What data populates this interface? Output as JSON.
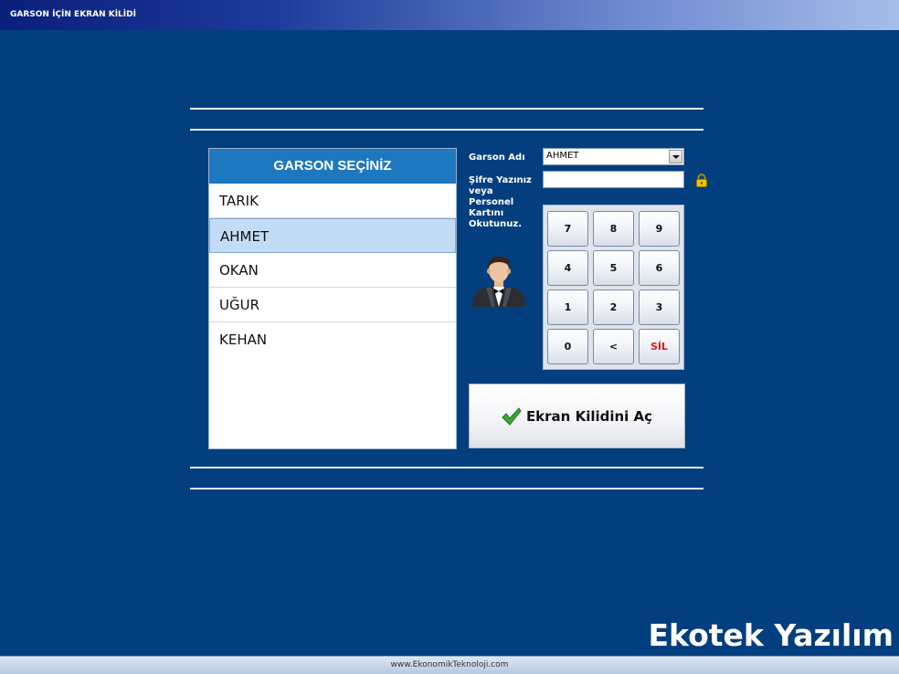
{
  "window": {
    "title": "GARSON İÇİN EKRAN KİLİDİ"
  },
  "waiter_list": {
    "header": "GARSON SEÇİNİZ",
    "items": [
      "TARIK",
      "AHMET",
      "OKAN",
      "UĞUR",
      "KEHAN"
    ],
    "selected": "AHMET"
  },
  "form": {
    "waiter_name_label": "Garson Adı",
    "waiter_name_value": "AHMET",
    "password_label_lines": [
      "Şifre Yazınız",
      "veya",
      "Personel",
      "Kartını",
      "Okutunuz."
    ],
    "password_value": ""
  },
  "keypad": {
    "keys": [
      "7",
      "8",
      "9",
      "4",
      "5",
      "6",
      "1",
      "2",
      "3",
      "0",
      "<",
      "SİL"
    ]
  },
  "unlock_button": {
    "label": "Ekran Kilidini Aç"
  },
  "brand": "Ekotek Yazılım",
  "footer": {
    "url": "www.EkonomikTeknoloji.com"
  },
  "colors": {
    "background": "#033f7f",
    "list_header": "#1e78c0",
    "selected_row": "#c3dcf6",
    "delete_key": "#e01b1b"
  },
  "icons": {
    "lock": "lock-icon",
    "check": "check-icon",
    "waiter": "waiter-avatar-icon"
  }
}
